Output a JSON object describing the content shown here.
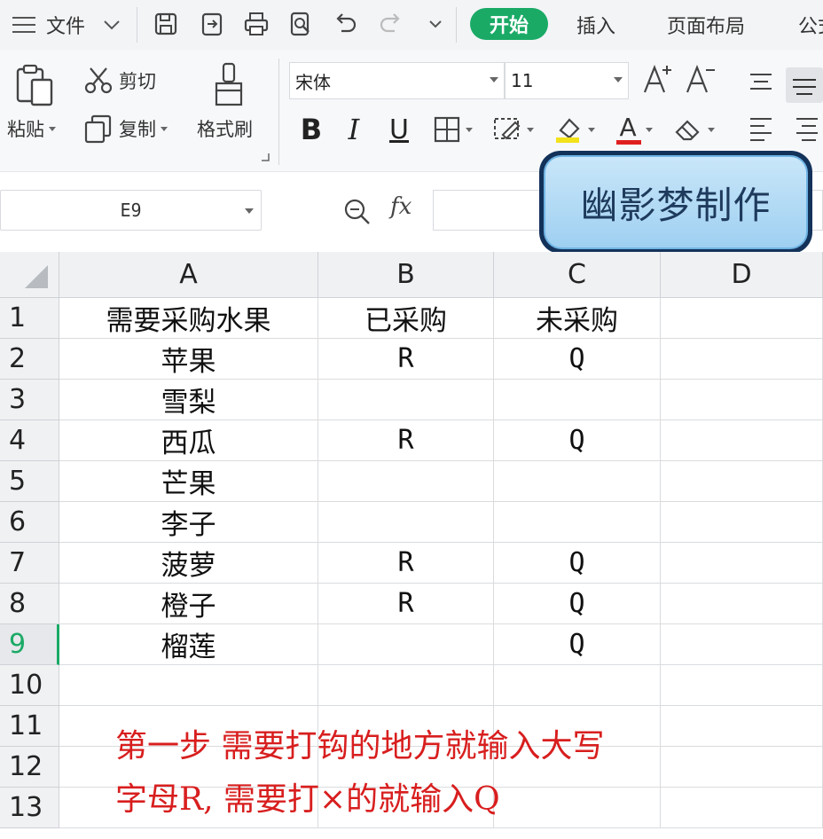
{
  "menubar": {
    "file_label": "文件",
    "tabs": [
      "开始",
      "插入",
      "页面布局",
      "公式"
    ]
  },
  "ribbon": {
    "paste_label": "粘贴",
    "cut_label": "剪切",
    "copy_label": "复制",
    "format_painter_label": "格式刷",
    "font_name": "宋体",
    "font_size": "11",
    "bold_glyph": "B",
    "italic_glyph": "I",
    "underline_glyph": "U",
    "font_color_glyph": "A"
  },
  "formula_bar": {
    "cell_reference": "E9",
    "fx_label": "fx",
    "content": ""
  },
  "watermark": "幽影梦制作",
  "sheet": {
    "columns": [
      "A",
      "B",
      "C",
      "D"
    ],
    "rows": [
      "1",
      "2",
      "3",
      "4",
      "5",
      "6",
      "7",
      "8",
      "9",
      "10",
      "11",
      "12",
      "13"
    ],
    "active_row": "9",
    "cells": [
      [
        "需要采购水果",
        "已采购",
        "未采购",
        ""
      ],
      [
        "苹果",
        "R",
        "Q",
        ""
      ],
      [
        "雪梨",
        "",
        "",
        ""
      ],
      [
        "西瓜",
        "R",
        "Q",
        ""
      ],
      [
        "芒果",
        "",
        "",
        ""
      ],
      [
        "李子",
        "",
        "",
        ""
      ],
      [
        "菠萝",
        "R",
        "Q",
        ""
      ],
      [
        "橙子",
        "R",
        "Q",
        ""
      ],
      [
        "榴莲",
        "",
        "Q",
        ""
      ],
      [
        "",
        "",
        "",
        ""
      ],
      [
        "",
        "",
        "",
        ""
      ],
      [
        "",
        "",
        "",
        ""
      ],
      [
        "",
        "",
        "",
        ""
      ]
    ]
  },
  "annotation": {
    "line1": "第一步  需要打钩的地方就输入大写",
    "line2": "字母R, 需要打×的就输入Q"
  },
  "colors": {
    "accent": "#1aaa66",
    "annotation": "#d81e1e"
  }
}
